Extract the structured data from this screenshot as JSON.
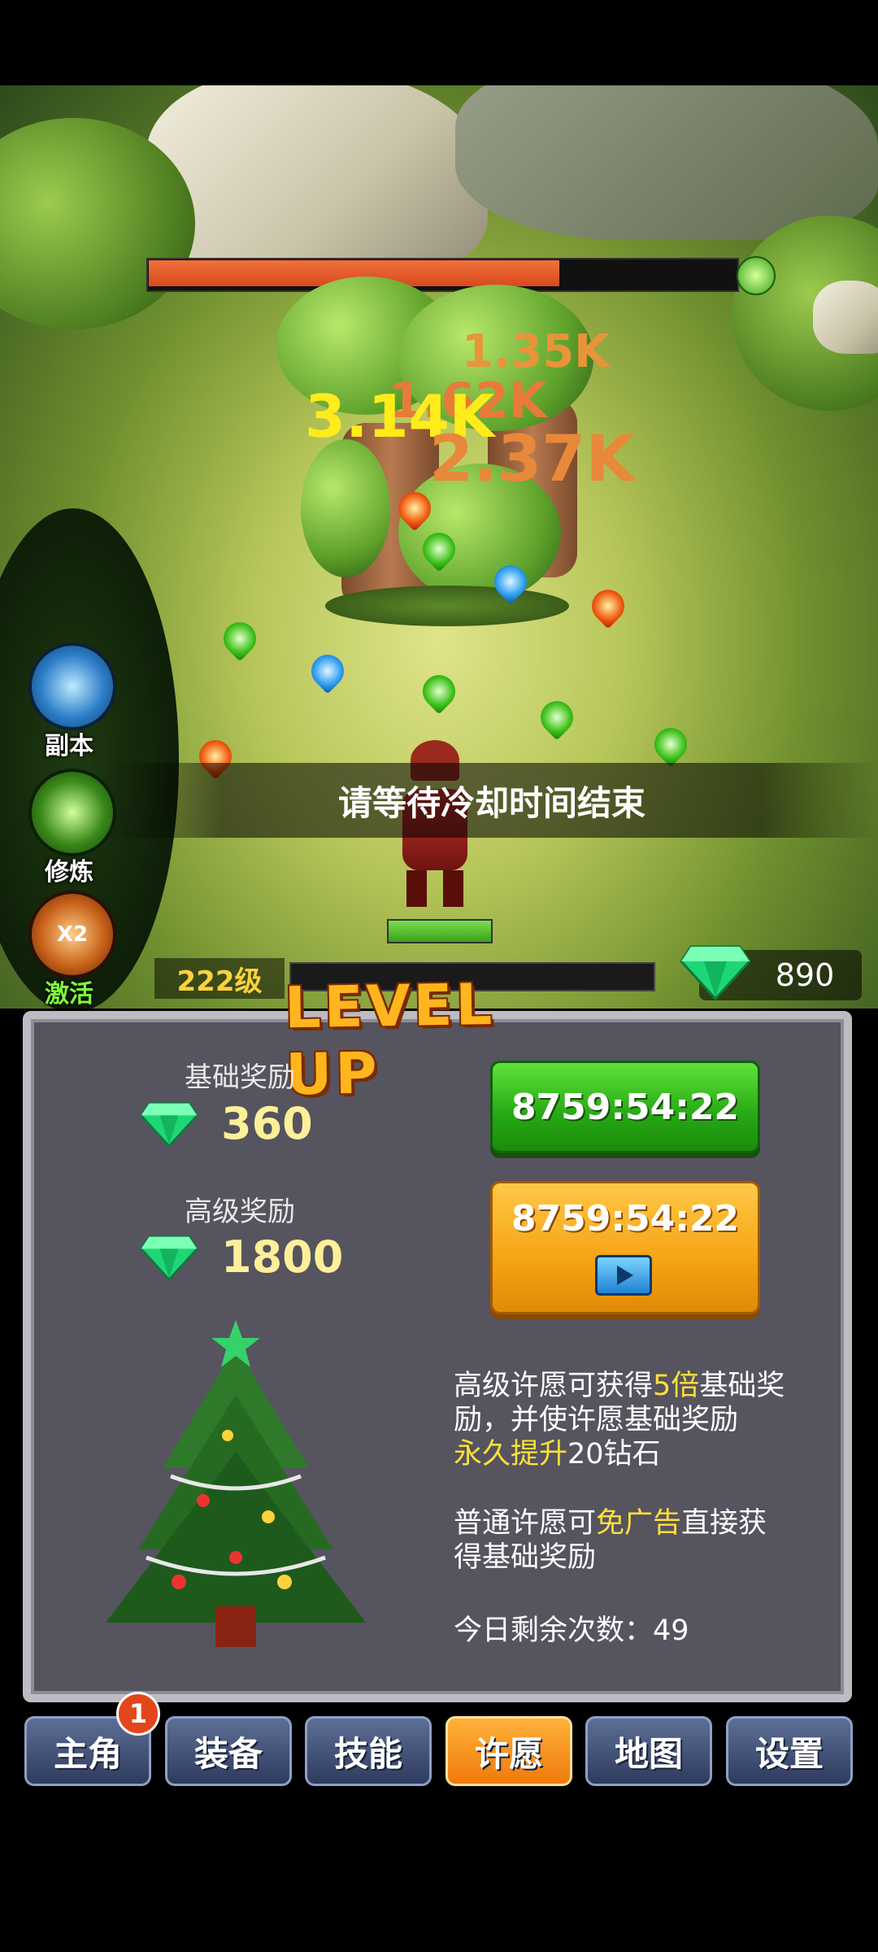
{
  "battle": {
    "damage_numbers": [
      "1.35K",
      "1.62K",
      "3.14K",
      "2.37K"
    ],
    "toast": "请等待冷却时间结束"
  },
  "side_menu": [
    {
      "label": "副本",
      "icon": "portal-icon"
    },
    {
      "label": "修炼",
      "icon": "training-icon"
    },
    {
      "label": "激活",
      "icon": "double-boost-icon",
      "badge": "X2"
    }
  ],
  "status": {
    "level": "222级",
    "gems": "890"
  },
  "panel": {
    "title": "LEVEL UP",
    "basic_reward_label": "基础奖励",
    "basic_reward_value": "360",
    "advanced_reward_label": "高级奖励",
    "advanced_reward_value": "1800",
    "basic_button_timer": "8759:54:22",
    "advanced_button_timer": "8759:54:22",
    "info1_a": "高级许愿可获得",
    "info1_b": "5倍",
    "info1_c": "基础",
    "info1_d": "奖励，并使许愿基础奖励",
    "info1_e": "永久提升",
    "info1_f": "20钻石",
    "info2_a": "普通许愿可",
    "info2_b": "免广告",
    "info2_c": "直接获",
    "info2_d": "得基础奖励",
    "remaining": "今日剩余次数：49"
  },
  "tabs": [
    {
      "label": "主角",
      "badge": "1"
    },
    {
      "label": "装备"
    },
    {
      "label": "技能"
    },
    {
      "label": "许愿",
      "active": true
    },
    {
      "label": "地图"
    },
    {
      "label": "设置"
    }
  ],
  "colors": {
    "boss_hp": "#e85a2a",
    "highlight": "#ffe03a",
    "active_tab": "#f5961a"
  }
}
